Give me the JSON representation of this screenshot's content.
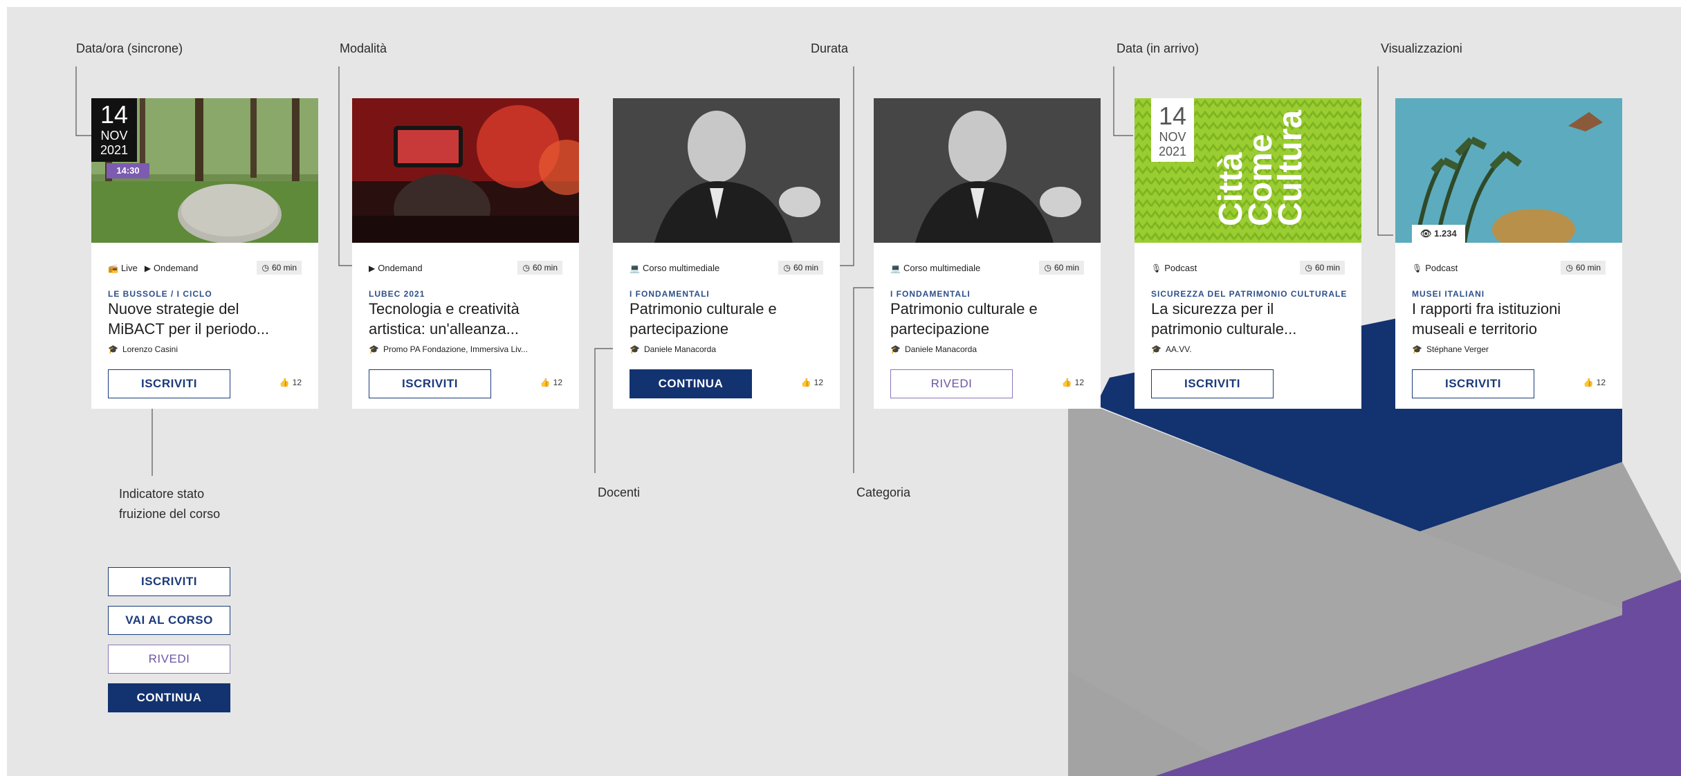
{
  "annotations": {
    "date_sync": "Data/ora (sincrone)",
    "mode": "Modalità",
    "duration": "Durata",
    "date_incoming": "Data (in arrivo)",
    "views": "Visualizzazioni",
    "status_indicator": "Indicatore stato fruizione del corso",
    "teachers": "Docenti",
    "category": "Categoria"
  },
  "cards": [
    {
      "image": "park-stone-photo",
      "date": {
        "day": "14",
        "month": "NOV",
        "year": "2021",
        "time": "14:30"
      },
      "modes": [
        {
          "icon": "broadcast-icon",
          "label": "Live"
        },
        {
          "icon": "play-icon",
          "label": "Ondemand"
        }
      ],
      "duration": "60 min",
      "category": "LE BUSSOLE / I CICLO",
      "title_line1": "Nuove strategie del",
      "title_line2": "MiBACT per il periodo...",
      "teacher": "Lorenzo Casini",
      "button": "ISCRIVITI",
      "likes": "12"
    },
    {
      "image": "stage-smartphone-photo",
      "modes": [
        {
          "icon": "play-icon",
          "label": "Ondemand"
        }
      ],
      "duration": "60 min",
      "category": "LUBEC 2021",
      "title_line1": "Tecnologia e creatività",
      "title_line2": "artistica: un'alleanza...",
      "teacher": "Promo PA Fondazione, Immersiva Liv...",
      "button": "ISCRIVITI",
      "likes": "12"
    },
    {
      "image": "speaker-bw-photo",
      "modes": [
        {
          "icon": "laptop-icon",
          "label": "Corso multimediale"
        }
      ],
      "duration": "60 min",
      "category": "I FONDAMENTALI",
      "title_line1": "Patrimonio culturale e",
      "title_line2": "partecipazione",
      "teacher": "Daniele Manacorda",
      "button": "CONTINUA",
      "likes": "12"
    },
    {
      "image": "speaker-bw-photo",
      "modes": [
        {
          "icon": "laptop-icon",
          "label": "Corso multimediale"
        }
      ],
      "duration": "60 min",
      "category": "I FONDAMENTALI",
      "title_line1": "Patrimonio culturale e",
      "title_line2": "partecipazione",
      "teacher": "Daniele Manacorda",
      "button": "RIVEDI",
      "likes": "12"
    },
    {
      "image": "citta-come-cultura-poster",
      "poster_words": [
        "Città",
        "Come",
        "Cultura"
      ],
      "date": {
        "day": "14",
        "month": "NOV",
        "year": "2021"
      },
      "modes": [
        {
          "icon": "podcast-icon",
          "label": "Podcast"
        }
      ],
      "duration": "60 min",
      "category": "SICUREZZA DEL PATRIMONIO CULTURALE",
      "title_line1": "La sicurezza per il",
      "title_line2": "patrimonio culturale...",
      "teacher": "AA.VV.",
      "button": "ISCRIVITI",
      "likes": ""
    },
    {
      "image": "fresco-bird-plants",
      "views": "1.234",
      "modes": [
        {
          "icon": "podcast-icon",
          "label": "Podcast"
        }
      ],
      "duration": "60 min",
      "category": "MUSEI ITALIANI",
      "title_line1": "I rapporti fra istituzioni",
      "title_line2": "museali e territorio",
      "teacher": "Stéphane Verger",
      "button": "ISCRIVITI",
      "likes": "12"
    }
  ],
  "legend_buttons": [
    "ISCRIVITI",
    "VAI AL CORSO",
    "RIVEDI",
    "CONTINUA"
  ],
  "colors": {
    "background": "#e6e6e6",
    "navy": "#133270",
    "purple": "#6b4b9e",
    "gray_shape": "#a3a3a3",
    "category_blue": "#2d4f8a",
    "poster_green": "#9acd32"
  }
}
